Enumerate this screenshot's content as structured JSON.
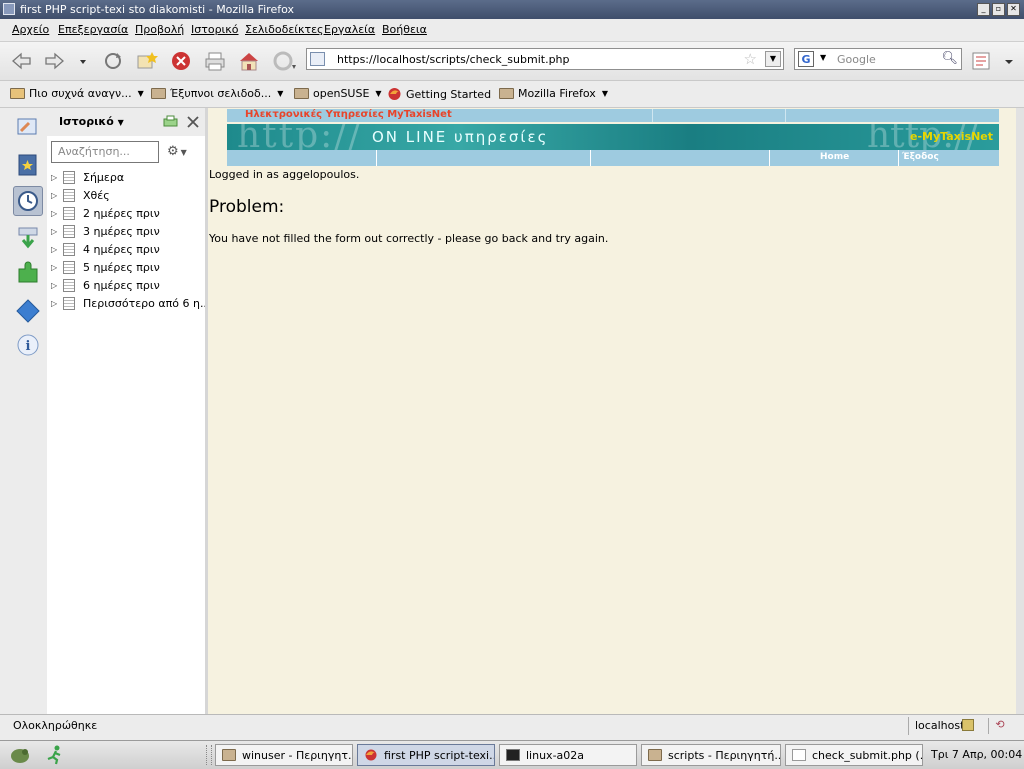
{
  "window": {
    "title": "first PHP script-texi sto diakomisti - Mozilla Firefox",
    "buttons": [
      "_",
      "▫",
      "✕"
    ]
  },
  "menubar": {
    "items": [
      "Αρχείο",
      "Επεξεργασία",
      "Προβολή",
      "Ιστορικό",
      "Σελιδοδείκτες",
      "Εργαλεία",
      "Βοήθεια"
    ]
  },
  "navigation": {
    "url": "https://localhost/scripts/check_submit.php",
    "search_placeholder": "Google",
    "search_engine": "G"
  },
  "bookmarks": {
    "items": [
      {
        "label": "Πιο συχνά αναγν...",
        "icon": "feed-folder-icon",
        "dropdown": true
      },
      {
        "label": "Έξυπνοι σελιδοδ...",
        "icon": "folder-icon",
        "dropdown": true
      },
      {
        "label": "openSUSE",
        "icon": "folder-icon",
        "dropdown": true
      },
      {
        "label": "Getting Started",
        "icon": "firefox-bookmark-icon",
        "dropdown": false
      },
      {
        "label": "Mozilla Firefox",
        "icon": "folder-icon",
        "dropdown": true
      }
    ]
  },
  "sidebar": {
    "title": "Ιστορικό",
    "search_placeholder": "Αναζήτηση...",
    "items": [
      "Σήμερα",
      "Χθές",
      "2 ημέρες πριν",
      "3 ημέρες πριν",
      "4 ημέρες πριν",
      "5 ημέρες πριν",
      "6 ημέρες πριν",
      "Περισσότερο από 6 η..."
    ]
  },
  "page": {
    "header_title": "Ηλεκτρονικές Υπηρεσίες MyTaxisNet",
    "banner_text": "ON LINE υπηρεσίες",
    "banner_brand": "e-MyTaxisNet",
    "nav_home": "Home",
    "nav_exit": "Έξοδος",
    "logged_in": "Logged in as aggelopoulos.",
    "problem_heading": "Problem:",
    "message": "You have not filled the form out correctly - please go back and try again."
  },
  "status": {
    "text": "Ολοκληρώθηκε",
    "host": "localhost"
  },
  "taskbar": {
    "tasks": [
      {
        "label": "winuser - Περιηγητ...",
        "active": false
      },
      {
        "label": "first PHP script-texi...",
        "active": true
      },
      {
        "label": "linux-a02a",
        "active": false
      },
      {
        "label": "scripts - Περιηγητή...",
        "active": false
      },
      {
        "label": "check_submit.php (...",
        "active": false
      }
    ],
    "clock": "Τρι 7 Απρ, 00:04"
  },
  "colors": {
    "page_bg": "#f6f2e0",
    "banner_teal": "#2a9c9c",
    "header_red": "#e8442a",
    "nav_blue": "#9ecbe0"
  }
}
